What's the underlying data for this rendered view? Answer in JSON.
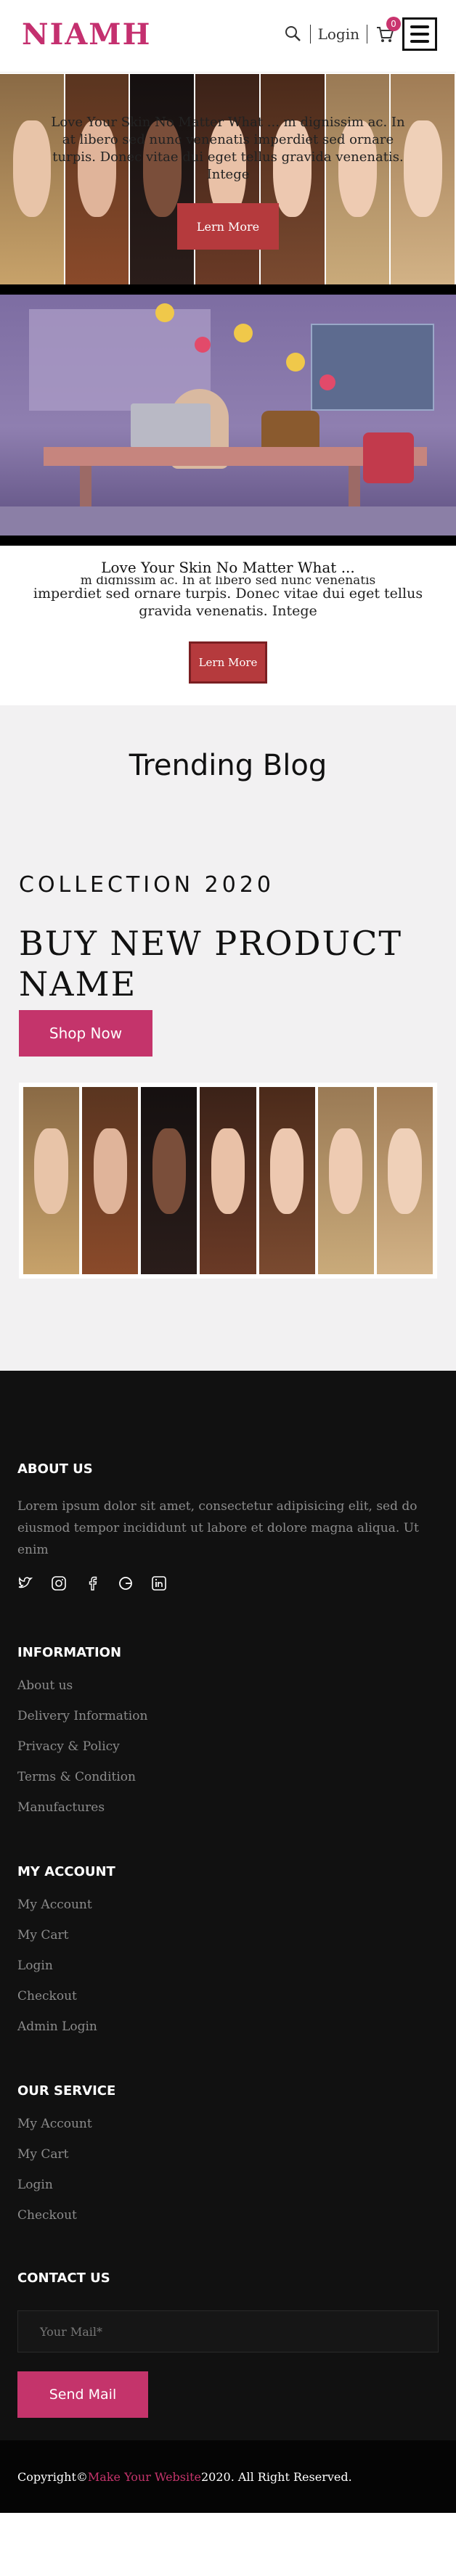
{
  "header": {
    "logo": "NIAMH",
    "login": "Login",
    "cart_count": "0"
  },
  "hero1": {
    "text": "Love Your Skin No Matter What ... m dignissim ac. In at libero sed nunc venenatis imperdiet sed ornare turpis. Donec vitae dui eget tellus gravida venenatis. Intege",
    "button": "Lern More"
  },
  "hero2": {
    "title": "Love Your Skin No Matter What ...",
    "body_partial": "m dignissim ac. In at libero sed nunc venenatis",
    "body": "imperdiet sed ornare turpis. Donec vitae dui eget tellus gravida venenatis. Intege",
    "button": "Lern More"
  },
  "trending": {
    "title": "Trending Blog"
  },
  "collection": {
    "kicker": "COLLECTION 2020",
    "title": "BUY NEW PRODUCT NAME",
    "button": "Shop Now"
  },
  "footer": {
    "about": {
      "title": "ABOUT US",
      "text": "Lorem ipsum dolor sit amet, consectetur adipisicing elit, sed do eiusmod tempor incididunt ut labore et dolore magna aliqua. Ut enim"
    },
    "information": {
      "title": "INFORMATION",
      "links": [
        "About us",
        "Delivery Information",
        "Privacy & Policy",
        "Terms & Condition",
        "Manufactures"
      ]
    },
    "account": {
      "title": "MY ACCOUNT",
      "links": [
        "My Account",
        "My Cart",
        "Login",
        "Checkout",
        "Admin Login"
      ]
    },
    "service": {
      "title": "OUR SERVICE",
      "links": [
        "My Account",
        "My Cart",
        "Login",
        "Checkout"
      ]
    },
    "contact": {
      "title": "CONTACT US",
      "placeholder": "Your Mail*",
      "button": "Send Mail"
    },
    "copyright": {
      "prefix": "Copyright© ",
      "brand": "Make Your Website",
      "suffix": " 2020. All Right Reserved."
    }
  },
  "colors": {
    "accent": "#c4346b",
    "button_red": "#b53a3d",
    "footer_bg": "#111111"
  }
}
